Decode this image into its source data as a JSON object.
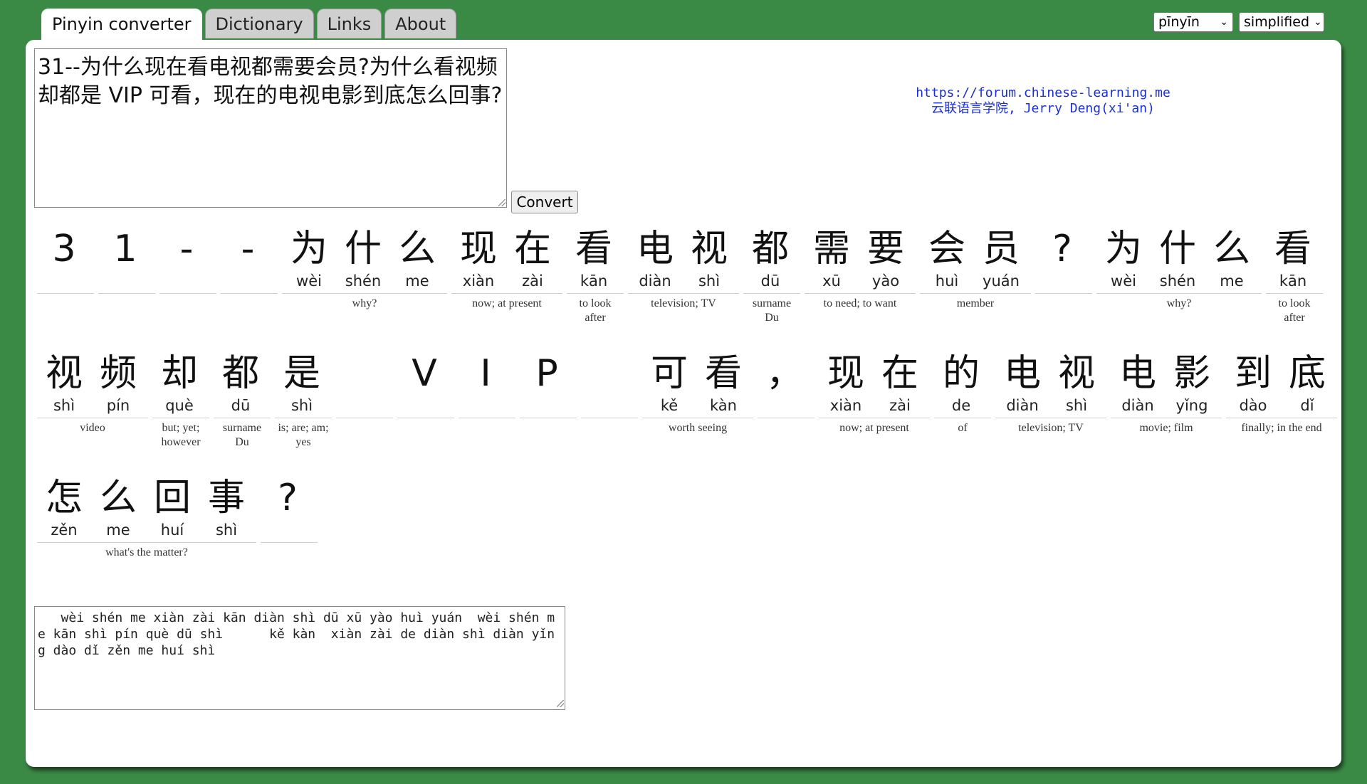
{
  "tabs": [
    {
      "label": "Pinyin converter",
      "active": true
    },
    {
      "label": "Dictionary",
      "active": false
    },
    {
      "label": "Links",
      "active": false
    },
    {
      "label": "About",
      "active": false
    }
  ],
  "selects": {
    "mode": "pīnyīn",
    "script": "simplified"
  },
  "input": {
    "value": "31--为什么现在看电视都需要会员?为什么看视频却都是 VIP 可看，现在的电视电影到底怎么回事?"
  },
  "convert_label": "Convert",
  "credit": {
    "url": "https://forum.chinese-learning.me",
    "line2": "云联语言学院, Jerry Deng(xi'an)"
  },
  "rows": [
    [
      {
        "syl": [
          [
            "3",
            ""
          ]
        ],
        "def": ""
      },
      {
        "syl": [
          [
            "1",
            ""
          ]
        ],
        "def": ""
      },
      {
        "syl": [
          [
            "-",
            ""
          ]
        ],
        "def": ""
      },
      {
        "syl": [
          [
            "-",
            ""
          ]
        ],
        "def": ""
      },
      {
        "syl": [
          [
            "为",
            "wèi"
          ],
          [
            "什",
            "shén"
          ],
          [
            "么",
            "me"
          ]
        ],
        "def": "why?"
      },
      {
        "syl": [
          [
            "现",
            "xiàn"
          ],
          [
            "在",
            "zài"
          ]
        ],
        "def": "now; at present"
      },
      {
        "syl": [
          [
            "看",
            "kān"
          ]
        ],
        "def": "to look after"
      },
      {
        "syl": [
          [
            "电",
            "diàn"
          ],
          [
            "视",
            "shì"
          ]
        ],
        "def": "television; TV"
      },
      {
        "syl": [
          [
            "都",
            "dū"
          ]
        ],
        "def": "surname Du"
      },
      {
        "syl": [
          [
            "需",
            "xū"
          ],
          [
            "要",
            "yào"
          ]
        ],
        "def": "to need; to want"
      },
      {
        "syl": [
          [
            "会",
            "huì"
          ],
          [
            "员",
            "yuán"
          ]
        ],
        "def": "member"
      },
      {
        "syl": [
          [
            "?",
            ""
          ]
        ],
        "def": ""
      },
      {
        "syl": [
          [
            "为",
            "wèi"
          ],
          [
            "什",
            "shén"
          ],
          [
            "么",
            "me"
          ]
        ],
        "def": "why?"
      },
      {
        "syl": [
          [
            "看",
            "kān"
          ]
        ],
        "def": "to look after"
      }
    ],
    [
      {
        "syl": [
          [
            "视",
            "shì"
          ],
          [
            "频",
            "pín"
          ]
        ],
        "def": "video"
      },
      {
        "syl": [
          [
            "却",
            "què"
          ]
        ],
        "def": "but; yet; however"
      },
      {
        "syl": [
          [
            "都",
            "dū"
          ]
        ],
        "def": "surname Du"
      },
      {
        "syl": [
          [
            "是",
            "shì"
          ]
        ],
        "def": "is; are; am; yes"
      },
      {
        "syl": [
          [
            "",
            ""
          ]
        ],
        "def": ""
      },
      {
        "syl": [
          [
            "V",
            ""
          ]
        ],
        "def": ""
      },
      {
        "syl": [
          [
            "I",
            ""
          ]
        ],
        "def": ""
      },
      {
        "syl": [
          [
            "P",
            ""
          ]
        ],
        "def": ""
      },
      {
        "syl": [
          [
            "",
            ""
          ]
        ],
        "def": ""
      },
      {
        "syl": [
          [
            "可",
            "kě"
          ],
          [
            "看",
            "kàn"
          ]
        ],
        "def": "worth seeing"
      },
      {
        "syl": [
          [
            "，",
            ""
          ]
        ],
        "def": ""
      },
      {
        "syl": [
          [
            "现",
            "xiàn"
          ],
          [
            "在",
            "zài"
          ]
        ],
        "def": "now; at present"
      },
      {
        "syl": [
          [
            "的",
            "de"
          ]
        ],
        "def": "of"
      },
      {
        "syl": [
          [
            "电",
            "diàn"
          ],
          [
            "视",
            "shì"
          ]
        ],
        "def": "television; TV"
      },
      {
        "syl": [
          [
            "电",
            "diàn"
          ],
          [
            "影",
            "yǐng"
          ]
        ],
        "def": "movie; film"
      },
      {
        "syl": [
          [
            "到",
            "dào"
          ],
          [
            "底",
            "dǐ"
          ]
        ],
        "def": "finally; in the end"
      }
    ],
    [
      {
        "syl": [
          [
            "怎",
            "zěn"
          ],
          [
            "么",
            "me"
          ],
          [
            "回",
            "huí"
          ],
          [
            "事",
            "shì"
          ]
        ],
        "def": "what's the matter?"
      },
      {
        "syl": [
          [
            "?",
            ""
          ]
        ],
        "def": ""
      }
    ]
  ],
  "output": {
    "value": "   wèi shén me xiàn zài kān diàn shì dū xū yào huì yuán  wèi shén me kān shì pín què dū shì      kě kàn  xiàn zài de diàn shì diàn yǐng dào dǐ zěn me huí shì"
  }
}
